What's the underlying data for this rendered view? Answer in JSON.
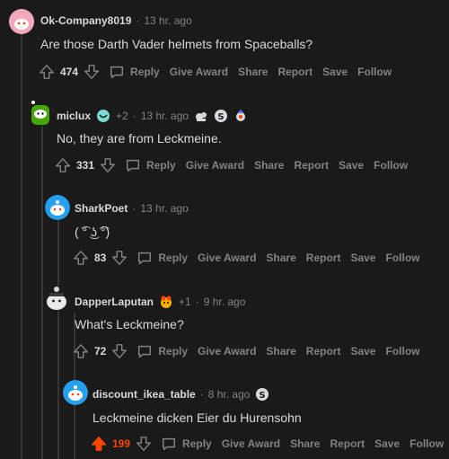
{
  "comments": [
    {
      "username": "Ok-Company8019",
      "time": "13 hr. ago",
      "body": "Are those Darth Vader helmets from Spaceballs?",
      "score": "474",
      "actions": {
        "reply": "Reply",
        "award": "Give Award",
        "share": "Share",
        "report": "Report",
        "save": "Save",
        "follow": "Follow"
      }
    },
    {
      "username": "miclux",
      "award_count": "+2",
      "time": "13 hr. ago",
      "body": "No, they are from Leckmeine.",
      "score": "331",
      "actions": {
        "reply": "Reply",
        "award": "Give Award",
        "share": "Share",
        "report": "Report",
        "save": "Save",
        "follow": "Follow"
      }
    },
    {
      "username": "SharkPoet",
      "time": "13 hr. ago",
      "body": "( ͡° ͜ʖ ͡°)",
      "score": "83",
      "actions": {
        "reply": "Reply",
        "award": "Give Award",
        "share": "Share",
        "report": "Report",
        "save": "Save",
        "follow": "Follow"
      }
    },
    {
      "username": "DapperLaputan",
      "award_count": "+1",
      "time": "9 hr. ago",
      "body": "What's Leckmeine?",
      "score": "72",
      "actions": {
        "reply": "Reply",
        "award": "Give Award",
        "share": "Share",
        "report": "Report",
        "save": "Save",
        "follow": "Follow"
      }
    },
    {
      "username": "discount_ikea_table",
      "time": "8 hr. ago",
      "body": "Leckmeine dicken Eier du Hurensohn",
      "score": "199",
      "actions": {
        "reply": "Reply",
        "award": "Give Award",
        "share": "Share",
        "report": "Report",
        "save": "Save",
        "follow": "Follow"
      }
    }
  ],
  "colors": {
    "background": "#1a1a1b",
    "text": "#d7dadc",
    "muted": "#818384",
    "upvote_active": "#ff4500",
    "thread_line": "#343536"
  }
}
